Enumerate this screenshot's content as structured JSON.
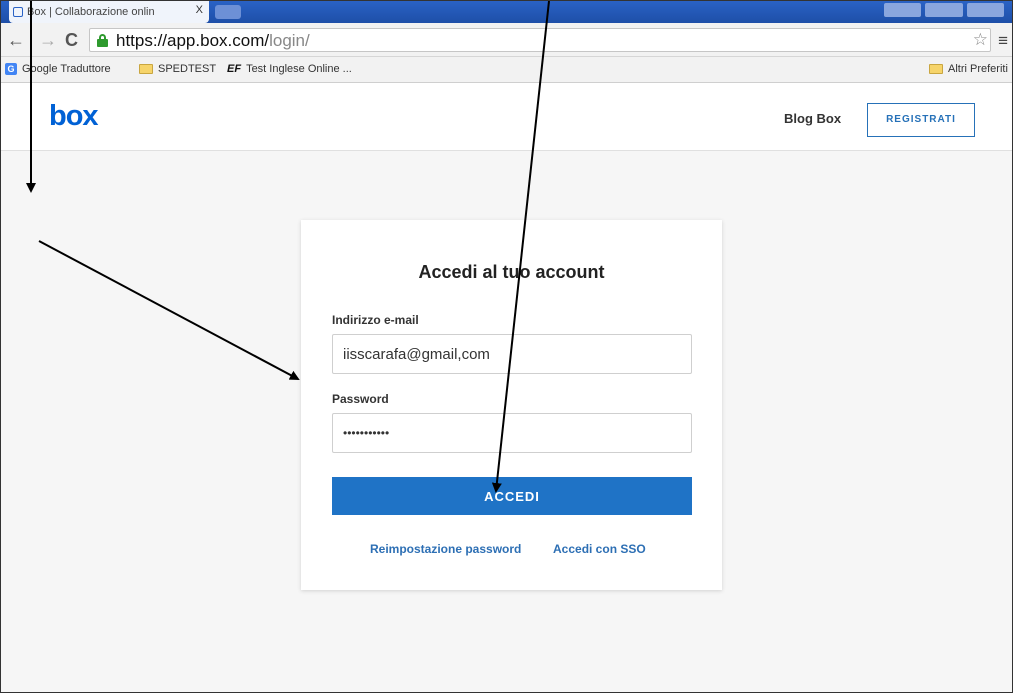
{
  "browser": {
    "tab_title": "Box | Collaborazione onlin",
    "tab_close": "X",
    "url_host": "https://app.box.com/",
    "url_path": "login/",
    "bookmarks": [
      {
        "label": "Google Traduttore",
        "icon": "google-translate-icon"
      },
      {
        "label": "SPEDTEST",
        "icon": "folder-icon"
      },
      {
        "label": "Test Inglese Online ...",
        "icon": "ef-icon"
      }
    ],
    "ef_mark": "EF",
    "other_bookmarks": "Altri Preferiti"
  },
  "header": {
    "logo": "box",
    "blog_link": "Blog Box",
    "register_button": "REGISTRATI"
  },
  "login": {
    "title": "Accedi al tuo account",
    "email_label": "Indirizzo e-mail",
    "email_value": "iisscarafa@gmail,com",
    "password_label": "Password",
    "password_value": "•••••••••••",
    "submit": "ACCEDI",
    "reset_link": "Reimpostazione password",
    "sso_link": "Accedi con SSO"
  },
  "colors": {
    "brand": "#0061d5",
    "button": "#1f73c6",
    "link": "#2d6fb4"
  }
}
